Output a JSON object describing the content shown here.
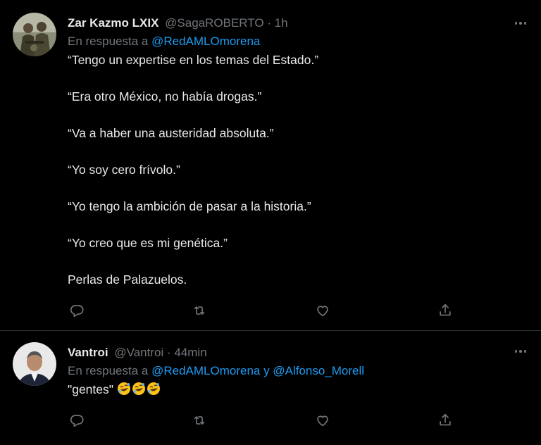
{
  "tweets": [
    {
      "display_name": "Zar Kazmo LXIX",
      "handle": "@SagaROBERTO",
      "separator": "·",
      "time": "1h",
      "reply_prefix": "En respuesta a",
      "reply_mentions": [
        "@RedAMLOmorena"
      ],
      "paragraphs": [
        "“Tengo un expertise en los temas del Estado.”",
        "“Era otro México, no había drogas.”",
        "“Va a haber una austeridad absoluta.”",
        "“Yo soy cero frívolo.”",
        "“Yo tengo la ambición de pasar a la historia.”",
        "“Yo creo que es mi genética.”",
        "Perlas de Palazuelos."
      ]
    },
    {
      "display_name": "Vantroi",
      "handle": "@Vantroi",
      "separator": "·",
      "time": "44min",
      "reply_prefix": "En respuesta a",
      "reply_mentions": [
        "@RedAMLOmorena",
        "@Alfonso_Morell"
      ],
      "reply_joiner": "y",
      "text": "\"gentes\"",
      "emojis": [
        "rolling-on-floor-laughing",
        "rolling-on-floor-laughing",
        "rolling-on-floor-laughing"
      ]
    }
  ],
  "actions": [
    "reply-icon",
    "retweet-icon",
    "like-icon",
    "share-icon"
  ],
  "colors": {
    "background": "#000000",
    "primary_text": "#e7e9ea",
    "secondary_text": "#71767b",
    "link": "#1d9bf0",
    "divider": "#2f3336"
  }
}
